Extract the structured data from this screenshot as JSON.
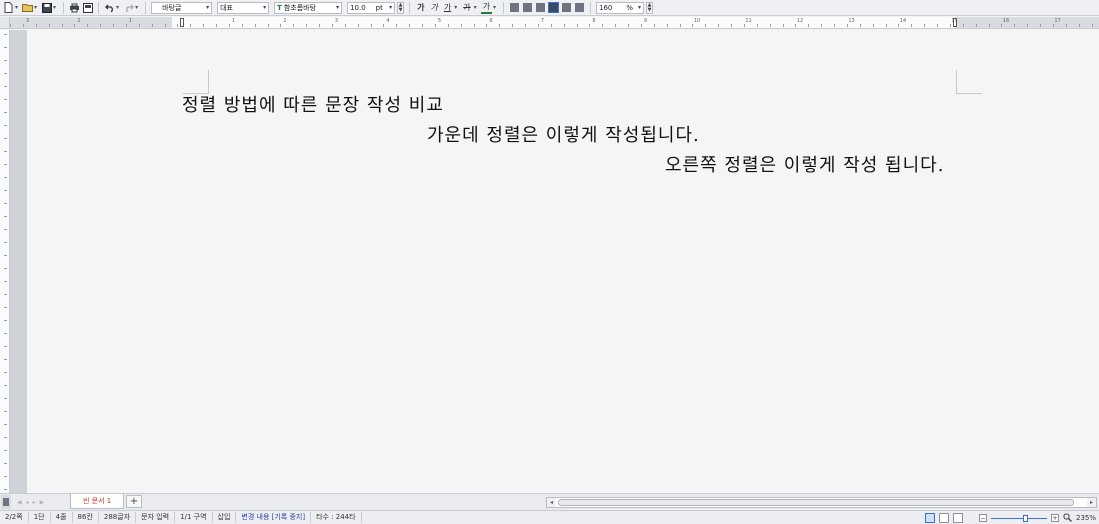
{
  "toolbar": {
    "style_combo": "바탕글",
    "lang_combo": "대표",
    "font_combo": "함초롬바탕",
    "font_size": "10.0",
    "size_unit": "pt",
    "bold_label": "가",
    "italic_label": "가",
    "underline_label": "가",
    "strike_label": "가",
    "color_label": "가",
    "zoom_value": "160",
    "zoom_unit": "%"
  },
  "ruler": {
    "numbers": [
      "3",
      "2",
      "1",
      "1",
      "2",
      "3",
      "4",
      "5",
      "6",
      "7",
      "8",
      "9",
      "10",
      "11",
      "12",
      "13",
      "14",
      "15",
      "16",
      "17"
    ]
  },
  "document": {
    "line1": "정렬 방법에 따른 문장 작성 비교",
    "line2": "가운데 정렬은 이렇게 작성됩니다.",
    "line3": "오른쪽 정렬은 이렇게 작성 됩니다."
  },
  "tabs": {
    "doc_tab": "빈 문서 1",
    "add_tab": "+"
  },
  "status": {
    "page": "2/2쪽",
    "column": "1단",
    "line": "4줄",
    "col_pos": "86칸",
    "chars": "288글자",
    "input_mode": "문자 입력",
    "section": "1/1 구역",
    "insert": "삽입",
    "track": "변경 내용 [기록 중지]",
    "typing": "타수 : 244타",
    "zoom": "235%"
  },
  "colors": {
    "accent": "#3b6fd1",
    "tab_text": "#c0392b"
  }
}
